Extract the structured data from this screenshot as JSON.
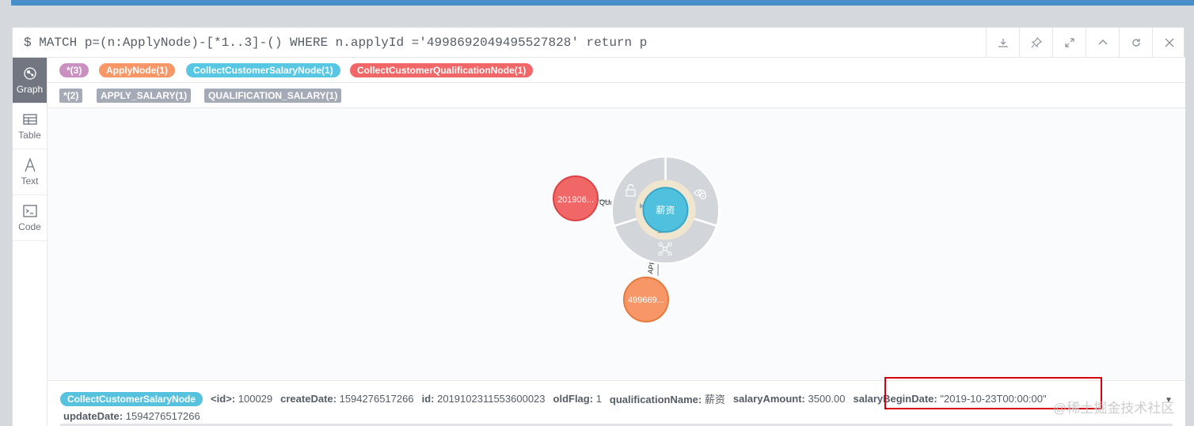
{
  "query": "$ MATCH p=(n:ApplyNode)-[*1..3]-() WHERE n.applyId ='4998692049495527828' return p",
  "toolbar": [
    "download-icon",
    "pin-icon",
    "expand-icon",
    "collapse-icon",
    "rerun-icon",
    "close-icon"
  ],
  "sidebar": [
    {
      "label": "Graph",
      "icon": "graph-icon",
      "active": true
    },
    {
      "label": "Table",
      "icon": "table-icon"
    },
    {
      "label": "Text",
      "icon": "text-icon"
    },
    {
      "label": "Code",
      "icon": "code-icon"
    }
  ],
  "labels": [
    {
      "text": "*(3)",
      "color": "#c990c0"
    },
    {
      "text": "ApplyNode(1)",
      "color": "#f79767"
    },
    {
      "text": "CollectCustomerSalaryNode(1)",
      "color": "#57c7e3"
    },
    {
      "text": "CollectCustomerQualificationNode(1)",
      "color": "#f16667"
    }
  ],
  "relationships": [
    "*(2)",
    "APPLY_SALARY(1)",
    "QUALIFICATION_SALARY(1)"
  ],
  "graph": {
    "center_node": {
      "caption": "薪资",
      "color": "#4fc1df"
    },
    "qualification_node": {
      "caption": "201906...",
      "color": "#f16667"
    },
    "apply_node": {
      "caption": "499669...",
      "color": "#f79767"
    },
    "rel_qualification_label": "QUA",
    "rel_apply_label": "APP"
  },
  "inspector": {
    "label": "CollectCustomerSalaryNode",
    "props": [
      {
        "key": "<id>:",
        "value": "100029"
      },
      {
        "key": "createDate:",
        "value": "1594276517266"
      },
      {
        "key": "id:",
        "value": "2019102311553600023"
      },
      {
        "key": "oldFlag:",
        "value": "1"
      },
      {
        "key": "qualificationName:",
        "value": "薪资"
      },
      {
        "key": "salaryAmount:",
        "value": "3500.00"
      },
      {
        "key": "salaryBeginDate:",
        "value": "\"2019-10-23T00:00:00\""
      }
    ],
    "line2_key": "updateDate:",
    "line2_value": "1594276517266"
  },
  "watermark": "@稀土掘金技术社区"
}
